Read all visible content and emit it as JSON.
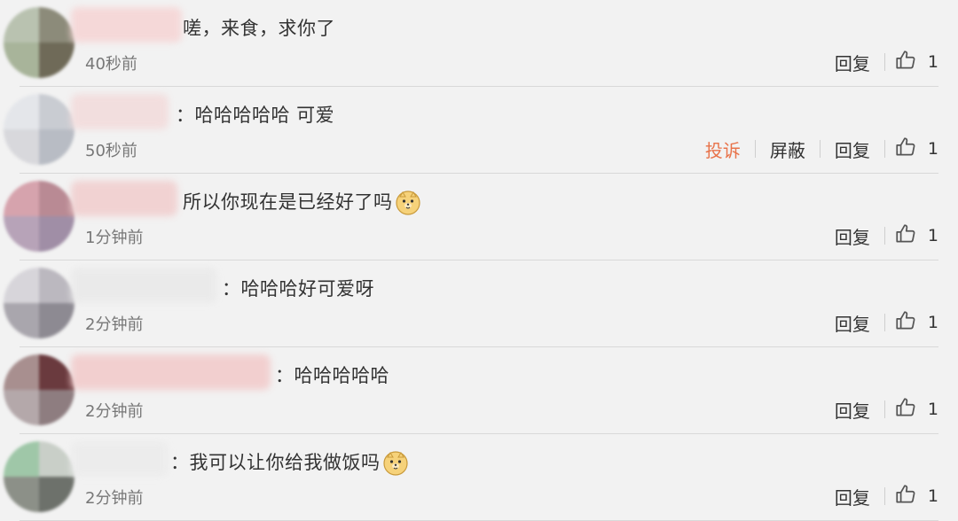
{
  "comments": [
    {
      "text": "嗟，来食，求你了",
      "time": "40秒前",
      "actions": [
        "回复"
      ],
      "likes": "1",
      "emoji": false,
      "avatar_colors": [
        "#b9c2b0",
        "#8c8b7a",
        "#a8b49a",
        "#6f6a58"
      ],
      "name_color": "#f6d6d6"
    },
    {
      "text": "：哈哈哈哈哈 可爱",
      "time": "50秒前",
      "actions": [
        "投诉",
        "屏蔽",
        "回复"
      ],
      "likes": "1",
      "emoji": false,
      "avatar_colors": [
        "#e4e6ea",
        "#c9ccd2",
        "#d8d8dc",
        "#b8bcc4"
      ],
      "name_color": "#f3dcdc"
    },
    {
      "text": "所以你现在是已经好了吗",
      "time": "1分钟前",
      "actions": [
        "回复"
      ],
      "likes": "1",
      "emoji": true,
      "avatar_colors": [
        "#d6a3ad",
        "#b98a94",
        "#b7a3b8",
        "#a08ea6"
      ],
      "name_color": "#f1cfcf"
    },
    {
      "text": "：哈哈哈好可爱呀",
      "time": "2分钟前",
      "actions": [
        "回复"
      ],
      "likes": "1",
      "emoji": false,
      "avatar_colors": [
        "#d7d5da",
        "#bbb8bf",
        "#a9a6ad",
        "#8d8a92"
      ],
      "name_color": "#eaeaea"
    },
    {
      "text": "：哈哈哈哈哈",
      "time": "2分钟前",
      "actions": [
        "回复"
      ],
      "likes": "1",
      "emoji": false,
      "avatar_colors": [
        "#a88f8f",
        "#6a3a3e",
        "#b4a8aa",
        "#8e7d80"
      ],
      "name_color": "#f2cccc"
    },
    {
      "text": "：我可以让你给我做饭吗",
      "time": "2分钟前",
      "actions": [
        "回复"
      ],
      "likes": "1",
      "emoji": true,
      "avatar_colors": [
        "#9fc7a8",
        "#c9cfc8",
        "#8c9088",
        "#6d716b"
      ],
      "name_color": "#ececec"
    }
  ],
  "colors": {
    "report": "#e8734a",
    "divider": "#d9d9d9",
    "background": "#f2f2f2"
  },
  "icons": {
    "like": "thumbs-up-icon",
    "emoji": "doge-emoji-icon"
  }
}
